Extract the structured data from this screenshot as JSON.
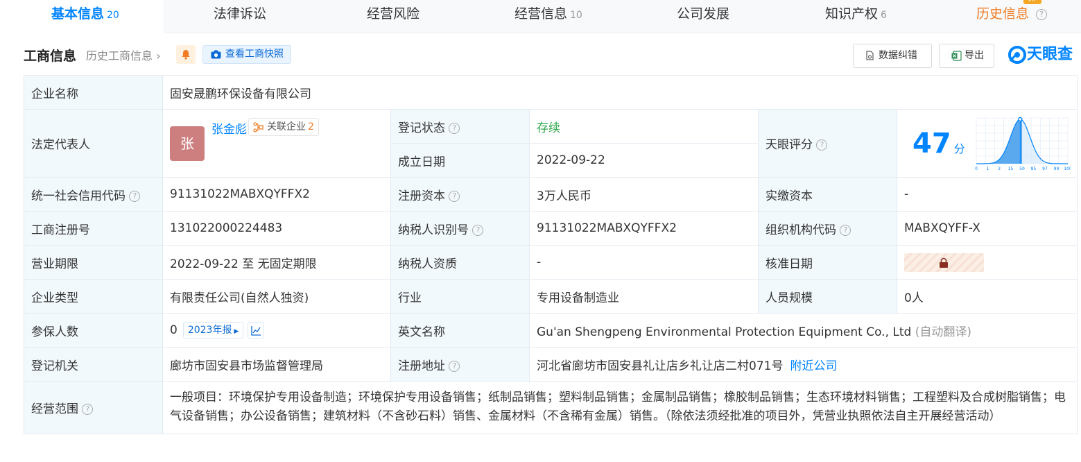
{
  "tabs": [
    {
      "label": "基本信息",
      "count": "20"
    },
    {
      "label": "法律诉讼",
      "count": ""
    },
    {
      "label": "经营风险",
      "count": ""
    },
    {
      "label": "经营信息",
      "count": "10"
    },
    {
      "label": "公司发展",
      "count": ""
    },
    {
      "label": "知识产权",
      "count": "6"
    },
    {
      "label": "历史信息",
      "count": ""
    }
  ],
  "header": {
    "title": "工商信息",
    "history_link": "历史工商信息",
    "snapshot_btn": "查看工商快照",
    "correct_btn": "数据纠错",
    "export_btn": "导出",
    "logo_text": "天眼查"
  },
  "info": {
    "company_name_label": "企业名称",
    "company_name": "固安晟鹏环保设备有限公司",
    "legal_rep_label": "法定代表人",
    "avatar_char": "张",
    "legal_rep": "张金彪",
    "related_label": "关联企业",
    "related_count": "2",
    "reg_status_label": "登记状态",
    "reg_status": "存续",
    "found_date_label": "成立日期",
    "found_date": "2022-09-22",
    "tyc_score_label": "天眼评分",
    "score": "47",
    "score_unit": "分",
    "credit_code_label": "统一社会信用代码",
    "credit_code": "91131022MABXQYFFX2",
    "reg_capital_label": "注册资本",
    "reg_capital": "3万人民币",
    "paid_capital_label": "实缴资本",
    "paid_capital": "-",
    "reg_no_label": "工商注册号",
    "reg_no": "131022000224483",
    "taxpayer_id_label": "纳税人识别号",
    "taxpayer_id": "91131022MABXQYFFX2",
    "org_code_label": "组织机构代码",
    "org_code": "MABXQYFF-X",
    "term_label": "营业期限",
    "term": "2022-09-22 至 无固定期限",
    "taxpayer_qual_label": "纳税人资质",
    "taxpayer_qual": "-",
    "approve_date_label": "核准日期",
    "type_label": "企业类型",
    "type": "有限责任公司(自然人独资)",
    "industry_label": "行业",
    "industry": "专用设备制造业",
    "staff_label": "人员规模",
    "staff": "0人",
    "insured_label": "参保人数",
    "insured": "0",
    "report_btn": "2023年报",
    "en_name_label": "英文名称",
    "en_name": "Gu'an Shengpeng Environmental Protection Equipment Co., Ltd",
    "en_note": "(自动翻译)",
    "authority_label": "登记机关",
    "authority": "廊坊市固安县市场监督管理局",
    "address_label": "注册地址",
    "address": "河北省廊坊市固安县礼让店乡礼让店二村071号",
    "nearby": "附近公司",
    "scope_label": "经营范围",
    "scope": "一般项目：环境保护专用设备制造；环境保护专用设备销售；纸制品销售；塑料制品销售；金属制品销售；橡胶制品销售；生态环境材料销售；工程塑料及合成树脂销售；电气设备销售；办公设备销售；建筑材料（不含砂石料）销售、金属材料（不含稀有金属）销售。（除依法须经批准的项目外，凭营业执照依法自主开展经营活动）"
  },
  "score_chart": {
    "tick_labels": [
      "0",
      "1",
      "3",
      "15",
      "50",
      "85",
      "97",
      "99",
      "100"
    ],
    "marker": "47"
  },
  "colors": {
    "accent": "#0084ff",
    "orange": "#f07c24",
    "green": "#2fa84f",
    "label_bg": "#f2f9fc"
  }
}
